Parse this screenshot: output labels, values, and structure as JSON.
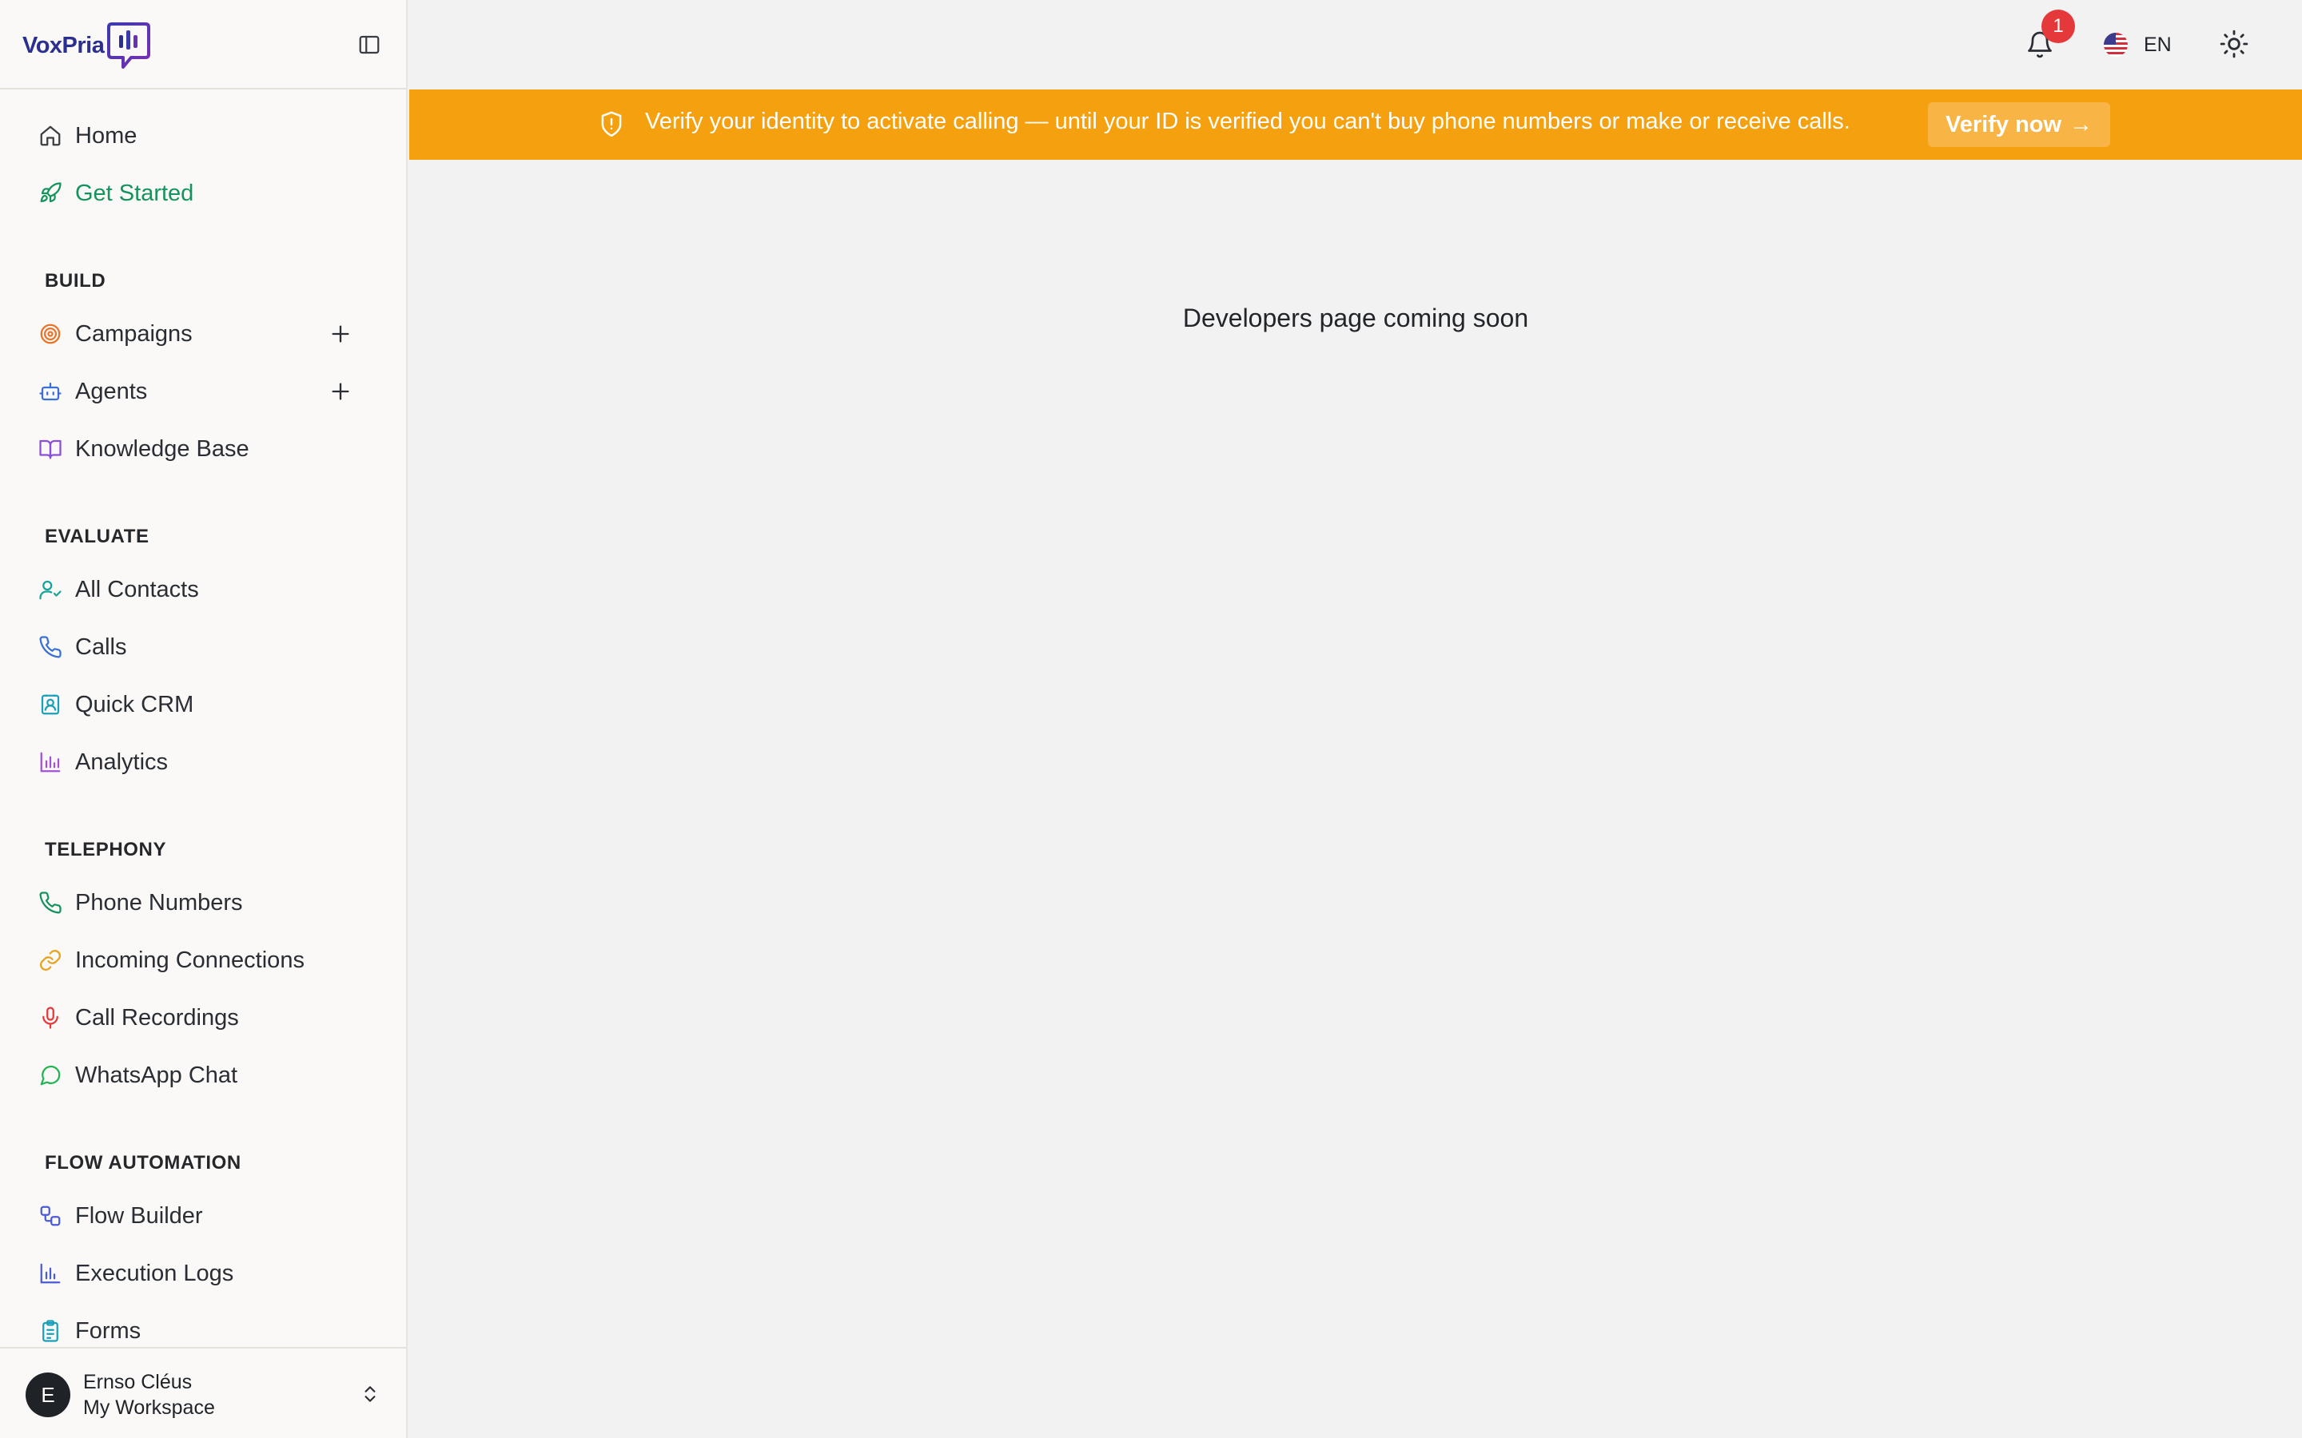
{
  "brand": {
    "logo_text": "VoxPria"
  },
  "sidebar": {
    "top_items": [
      {
        "label": "Home",
        "icon": "home-icon"
      },
      {
        "label": "Get Started",
        "icon": "rocket-icon",
        "active": true
      }
    ],
    "sections": [
      {
        "title": "BUILD",
        "items": [
          {
            "label": "Campaigns",
            "icon": "target-icon"
          },
          {
            "label": "Agents",
            "icon": "bot-icon"
          },
          {
            "label": "Knowledge Base",
            "icon": "book-open-icon"
          }
        ]
      },
      {
        "title": "EVALUATE",
        "items": [
          {
            "label": "All Contacts",
            "icon": "user-check-icon"
          },
          {
            "label": "Calls",
            "icon": "phone-icon"
          },
          {
            "label": "Quick CRM",
            "icon": "contact-card-icon"
          },
          {
            "label": "Analytics",
            "icon": "bar-chart-icon"
          }
        ]
      },
      {
        "title": "TELEPHONY",
        "items": [
          {
            "label": "Phone Numbers",
            "icon": "phone-icon"
          },
          {
            "label": "Incoming Connections",
            "icon": "link-icon"
          },
          {
            "label": "Call Recordings",
            "icon": "microphone-icon"
          },
          {
            "label": "WhatsApp Chat",
            "icon": "message-circle-icon"
          }
        ]
      },
      {
        "title": "FLOW AUTOMATION",
        "items": [
          {
            "label": "Flow Builder",
            "icon": "workflow-icon"
          },
          {
            "label": "Execution Logs",
            "icon": "bar-chart-icon"
          },
          {
            "label": "Forms",
            "icon": "clipboard-list-icon"
          }
        ]
      }
    ],
    "user": {
      "initial": "E",
      "name": "Ernso Cléus",
      "workspace": "My Workspace"
    }
  },
  "topbar": {
    "notification_count": "1",
    "language_code": "EN"
  },
  "banner": {
    "message": "Verify your identity to activate calling — until your ID is verified you can't buy phone numbers or make or receive calls.",
    "cta_label": "Verify now",
    "cta_arrow": "→"
  },
  "main": {
    "message": "Developers page coming soon"
  },
  "colors": {
    "accent_green": "#15935d",
    "banner_bg": "#f5a10f",
    "badge_red": "#e5383b",
    "sidebar_bg": "#faf9f7",
    "content_bg": "#f2f2f2"
  }
}
